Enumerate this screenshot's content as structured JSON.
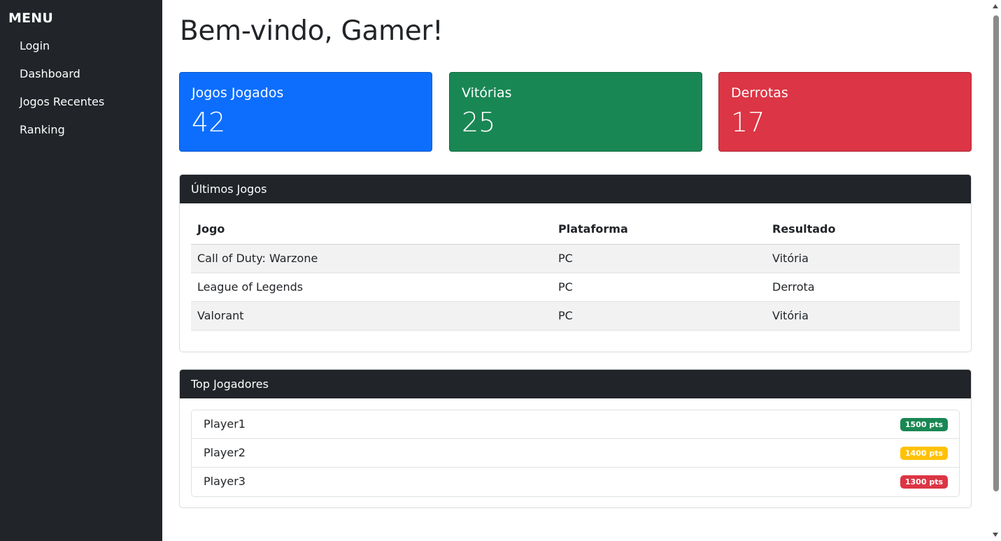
{
  "sidebar": {
    "title": "MENU",
    "items": [
      {
        "label": "Login"
      },
      {
        "label": "Dashboard"
      },
      {
        "label": "Jogos Recentes"
      },
      {
        "label": "Ranking"
      }
    ]
  },
  "main": {
    "title": "Bem-vindo, Gamer!",
    "stats": [
      {
        "label": "Jogos Jogados",
        "value": "42",
        "color": "#0d6efd"
      },
      {
        "label": "Vitórias",
        "value": "25",
        "color": "#198754"
      },
      {
        "label": "Derrotas",
        "value": "17",
        "color": "#dc3545"
      }
    ],
    "recent_games": {
      "title": "Últimos Jogos",
      "columns": [
        "Jogo",
        "Plataforma",
        "Resultado"
      ],
      "rows": [
        [
          "Call of Duty: Warzone",
          "PC",
          "Vitória"
        ],
        [
          "League of Legends",
          "PC",
          "Derrota"
        ],
        [
          "Valorant",
          "PC",
          "Vitória"
        ]
      ]
    },
    "top_players": {
      "title": "Top Jogadores",
      "players": [
        {
          "name": "Player1",
          "points": "1500 pts",
          "color": "#198754"
        },
        {
          "name": "Player2",
          "points": "1400 pts",
          "color": "#ffc107"
        },
        {
          "name": "Player3",
          "points": "1300 pts",
          "color": "#dc3545"
        }
      ]
    }
  }
}
